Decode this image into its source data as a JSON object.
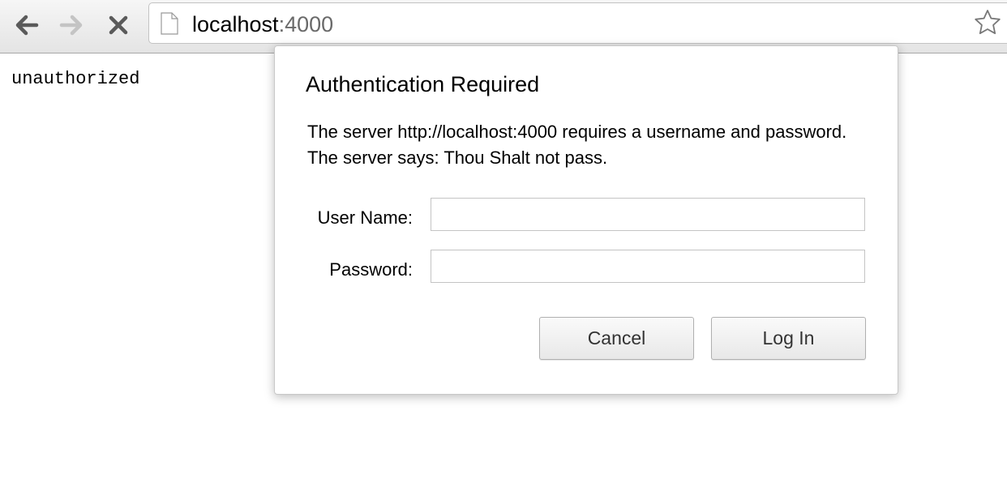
{
  "browser": {
    "url_host": "localhost",
    "url_port": ":4000",
    "icons": [
      "back-arrow-icon",
      "forward-arrow-icon",
      "stop-icon",
      "page-icon",
      "star-icon"
    ]
  },
  "page": {
    "body_text": "unauthorized"
  },
  "dialog": {
    "title": "Authentication Required",
    "message": "The server http://localhost:4000 requires a username and password. The server says: Thou Shalt not pass.",
    "username_label": "User Name:",
    "username_value": "",
    "password_label": "Password:",
    "password_value": "",
    "cancel_label": "Cancel",
    "login_label": "Log In"
  }
}
